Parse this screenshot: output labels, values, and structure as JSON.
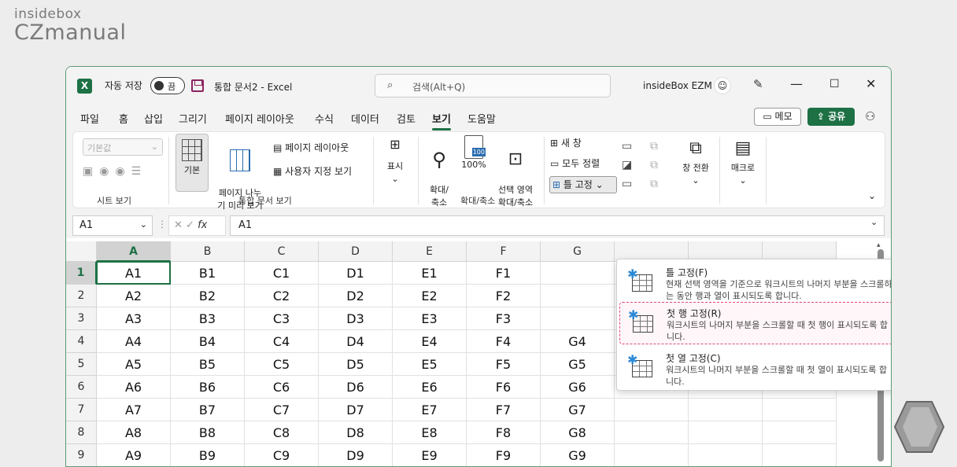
{
  "brand": {
    "line1": "insidebox",
    "line2": "CZmanual"
  },
  "titlebar": {
    "autosave_label": "자동 저장",
    "autosave_state": "끔",
    "doc_title": "통합 문서2  -  Excel",
    "search_placeholder": "검색(Alt+Q)",
    "user_name": "insideBox EZM"
  },
  "tabs": [
    "파일",
    "홈",
    "삽입",
    "그리기",
    "페이지 레이아웃",
    "수식",
    "데이터",
    "검토",
    "보기",
    "도움말"
  ],
  "active_tab": "보기",
  "buttons": {
    "memo": "메모",
    "share": "공유"
  },
  "ribbon": {
    "sheetview_select": "기본값",
    "sheetview_group": "시트 보기",
    "normal": "기본",
    "pagebreak": "페이지 나누\n기 미리 보기",
    "pagelayout": "페이지 레이아웃",
    "customview": "사용자 지정 보기",
    "workbookview_group": "통합 문서 보기",
    "show": "표시",
    "zoom": "확대/\n축소",
    "zoom100": "100%",
    "zoomsel": "선택 영역\n확대/축소",
    "zoom_group": "확대/축소",
    "newwin": "새 창",
    "arrange": "모두 정렬",
    "freeze": "틀 고정",
    "switch": "창 전환",
    "macro": "매크로"
  },
  "formula_bar": {
    "name_box": "A1",
    "fx": "fx",
    "value": "A1"
  },
  "sheet": {
    "columns": [
      "A",
      "B",
      "C",
      "D",
      "E",
      "F",
      "G"
    ],
    "rows": [
      [
        "1",
        "A1",
        "B1",
        "C1",
        "D1",
        "E1",
        "F1",
        ""
      ],
      [
        "2",
        "A2",
        "B2",
        "C2",
        "D2",
        "E2",
        "F2",
        ""
      ],
      [
        "3",
        "A3",
        "B3",
        "C3",
        "D3",
        "E3",
        "F3",
        ""
      ],
      [
        "4",
        "A4",
        "B4",
        "C4",
        "D4",
        "E4",
        "F4",
        "G4"
      ],
      [
        "5",
        "A5",
        "B5",
        "C5",
        "D5",
        "E5",
        "F5",
        "G5"
      ],
      [
        "6",
        "A6",
        "B6",
        "C6",
        "D6",
        "E6",
        "F6",
        "G6"
      ],
      [
        "7",
        "A7",
        "B7",
        "C7",
        "D7",
        "E7",
        "F7",
        "G7"
      ],
      [
        "8",
        "A8",
        "B8",
        "C8",
        "D8",
        "E8",
        "F8",
        "G8"
      ],
      [
        "9",
        "A9",
        "B9",
        "C9",
        "D9",
        "E9",
        "F9",
        "G9"
      ]
    ]
  },
  "freeze_menu": [
    {
      "title": "틀 고정(F)",
      "desc": "현재 선택 영역을 기준으로 워크시트의 나머지 부분을 스크롤하는 동안 행과 열이 표시되도록 합니다."
    },
    {
      "title": "첫 행 고정(R)",
      "desc": "워크시트의 나머지 부분을 스크롤할 때 첫 행이 표시되도록 합니다."
    },
    {
      "title": "첫 열 고정(C)",
      "desc": "워크시트의 나머지 부분을 스크롤할 때 첫 열이 표시되도록 합니다."
    }
  ],
  "colors": {
    "accent": "#1e7145",
    "highlight": "#e0457b"
  }
}
